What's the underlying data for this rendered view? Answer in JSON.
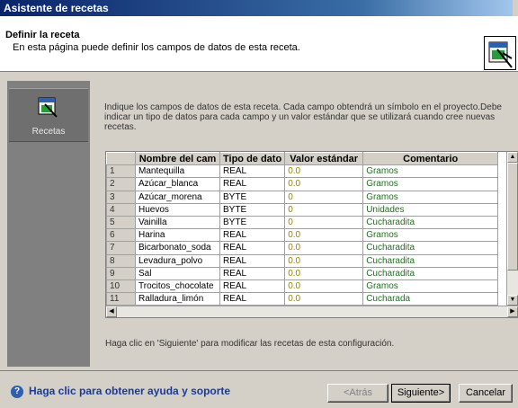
{
  "window": {
    "title": "Asistente de recetas"
  },
  "header": {
    "title": "Definir la receta",
    "subtitle": "En esta página puede definir los campos de datos de esta receta."
  },
  "sidebar": {
    "tab_label": "Recetas",
    "tab_icon": "recipe-icon"
  },
  "main": {
    "instructions": "Indique los campos de datos de esta receta. Cada campo obtendrá un símbolo en el proyecto.Debe indicar un tipo de datos para cada campo y un valor estándar que se utilizará cuando cree nuevas recetas.",
    "footnote": "Haga clic en 'Siguiente' para modificar las recetas de esta configuración."
  },
  "grid": {
    "columns": [
      "",
      "Nombre del cam",
      "Tipo de dato",
      "Valor estándar",
      "Comentario"
    ],
    "rows": [
      [
        "1",
        "Mantequilla",
        "REAL",
        "0.0",
        "Gramos"
      ],
      [
        "2",
        "Azúcar_blanca",
        "REAL",
        "0.0",
        "Gramos"
      ],
      [
        "3",
        "Azúcar_morena",
        "BYTE",
        "0",
        "Gramos"
      ],
      [
        "4",
        "Huevos",
        "BYTE",
        "0",
        "Unidades"
      ],
      [
        "5",
        "Vainilla",
        "BYTE",
        "0",
        "Cucharadita"
      ],
      [
        "6",
        "Harina",
        "REAL",
        "0.0",
        "Gramos"
      ],
      [
        "7",
        "Bicarbonato_soda",
        "REAL",
        "0.0",
        "Cucharadita"
      ],
      [
        "8",
        "Levadura_polvo",
        "REAL",
        "0.0",
        "Cucharadita"
      ],
      [
        "9",
        "Sal",
        "REAL",
        "0.0",
        "Cucharadita"
      ],
      [
        "10",
        "Trocitos_chocolate",
        "REAL",
        "0.0",
        "Gramos"
      ],
      [
        "11",
        "Ralladura_limón",
        "REAL",
        "0.0",
        "Cucharada"
      ]
    ]
  },
  "footer": {
    "help_text": "Haga clic para obtener ayuda y soporte",
    "back_label": "<Atrás",
    "next_label": "Siguiente>",
    "cancel_label": "Cancelar"
  },
  "colors": {
    "title_bar": "#0a246a",
    "value_text": "#a08000",
    "comment_text": "#207020",
    "help_link": "#1a3a9a"
  }
}
